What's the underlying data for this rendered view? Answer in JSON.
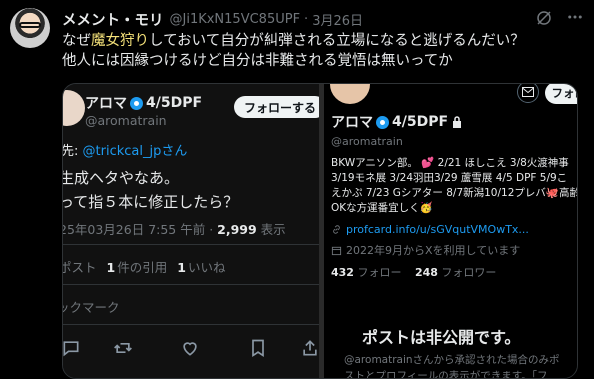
{
  "post": {
    "author_name": "メメント・モリ",
    "author_handle": "@Ji1KxN15VC85UPF",
    "separator": "·",
    "date": "3月26日",
    "text_line1_before": "なぜ",
    "text_line1_highlight": "魔女狩り",
    "text_line1_after": "しておいて自分が糾弾される立場になると逃げるんだい？",
    "text_line2": "他人には因縁つけるけど自分は非難される覚悟は無いってか"
  },
  "left_panel": {
    "name": "アロマ",
    "name_suffix": "4/5DPF",
    "handle": "@aromatrain",
    "follow_label": "フォローする",
    "reply_prefix": "先: ",
    "reply_link": "@trickcal_jpさん",
    "body_line1": "生成ヘタやなあ。",
    "body_line2": "って指５本に修正したら？",
    "timestamp": "25年03月26日 7:55 午前 · ",
    "views_count": "2,999",
    "views_label": " 表示",
    "stats_prefix": "ポスト",
    "quotes_count": "1",
    "quotes_label": "件の引用",
    "likes_count": "1",
    "likes_label": "いいね",
    "bookmarks_label": "ックマーク"
  },
  "right_panel": {
    "mail_icon": "mail-icon",
    "follow_label": "フォローする",
    "name": "アロマ",
    "name_suffix": "4/5DPF",
    "handle": "@aromatrain",
    "bio_line1": "BKWアニソン部。 💕 2/21 ほしこえ 3/8火渡神事",
    "bio_line2": "3/19モネ展 3/24羽田3/29 蘆雪展 4/5 DPF 5/9こ",
    "bio_line3": "えかぷ 7/23 Gシアター 8/7新潟10/12プレバ🐙高齢",
    "bio_line4": "OKな方運番宜しく🥳",
    "link": "profcard.info/u/sGVqutVMOwTx...",
    "joined": "2022年9月からXを利用しています",
    "following_count": "432",
    "following_label": " フォロー",
    "followers_count": "248",
    "followers_label": " フォロワー",
    "private_title": "ポストは非公開です。",
    "private_desc1": "@aromatrainさんから承認された場合のみポ",
    "private_desc2": "ストとプロフィールの表示ができます。「フ"
  },
  "colors": {
    "accent": "#1d9bf0",
    "highlight": "#f5e27a",
    "muted": "#71767b"
  }
}
